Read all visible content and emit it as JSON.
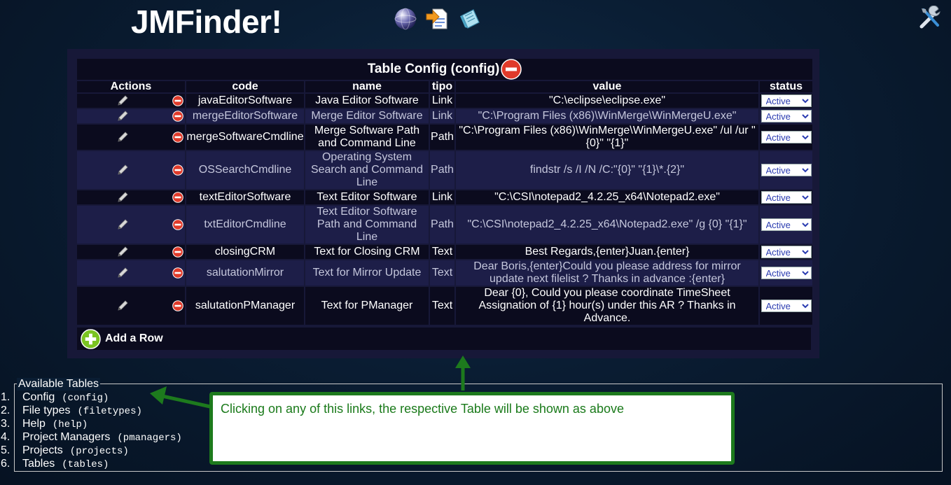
{
  "app": {
    "title": "JMFinder!",
    "icons": [
      "globe-icon",
      "import-icon",
      "notes-icon",
      "tools-icon"
    ]
  },
  "table_config": {
    "caption": "Table Config (config)",
    "headers": {
      "actions": "Actions",
      "code": "code",
      "name": "name",
      "tipo": "tipo",
      "value": "value",
      "status": "status"
    },
    "rows": [
      {
        "code": "javaEditorSoftware",
        "name": "Java Editor Software",
        "tipo": "Link",
        "value": "\"C:\\eclipse\\eclipse.exe\"",
        "status": "Active"
      },
      {
        "code": "mergeEditorSoftware",
        "name": "Merge Editor Software",
        "tipo": "Link",
        "value": "\"C:\\Program Files (x86)\\WinMerge\\WinMergeU.exe\"",
        "status": "Active"
      },
      {
        "code": "mergeSoftwareCmdline",
        "name": "Merge Software Path and Command Line",
        "tipo": "Path",
        "value": "\"C:\\Program Files (x86)\\WinMerge\\WinMergeU.exe\" /ul /ur \"{0}\" \"{1}\"",
        "status": "Active"
      },
      {
        "code": "OSSearchCmdline",
        "name": "Operating System Search and Command Line",
        "tipo": "Path",
        "value": "findstr /s /I /N /C:\"{0}\" \"{1}\\*.{2}\"",
        "status": "Active"
      },
      {
        "code": "textEditorSoftware",
        "name": "Text Editor Software",
        "tipo": "Link",
        "value": "\"C:\\CSI\\notepad2_4.2.25_x64\\Notepad2.exe\"",
        "status": "Active"
      },
      {
        "code": "txtEditorCmdline",
        "name": "Text Editor Software Path and Command Line",
        "tipo": "Path",
        "value": "\"C:\\CSI\\notepad2_4.2.25_x64\\Notepad2.exe\" /g {0} \"{1}\"",
        "status": "Active"
      },
      {
        "code": "closingCRM",
        "name": "Text for Closing CRM",
        "tipo": "Text",
        "value": "Best Regards,{enter}Juan.{enter}",
        "status": "Active"
      },
      {
        "code": "salutationMirror",
        "name": "Text for Mirror Update",
        "tipo": "Text",
        "value": "Dear Boris,{enter}Could you please address for mirror update next filelist ? Thanks in advance :{enter}",
        "status": "Active"
      },
      {
        "code": "salutationPManager",
        "name": "Text for PManager",
        "tipo": "Text",
        "value": "Dear {0}, Could you please coordinate TimeSheet Assignation of {1} hour(s) under this AR ? Thanks in Advance.",
        "status": "Active"
      }
    ],
    "add_row_label": "Add a Row"
  },
  "available_tables": {
    "legend": "Available Tables",
    "items": [
      {
        "num": "1.",
        "label": "Config",
        "code": "(config)"
      },
      {
        "num": "2.",
        "label": "File types",
        "code": "(filetypes)"
      },
      {
        "num": "3.",
        "label": "Help",
        "code": "(help)"
      },
      {
        "num": "4.",
        "label": "Project Managers",
        "code": "(pmanagers)"
      },
      {
        "num": "5.",
        "label": "Projects",
        "code": "(projects)"
      },
      {
        "num": "6.",
        "label": "Tables",
        "code": "(tables)"
      }
    ]
  },
  "callout": {
    "text": "Clicking on any of this links, the respective Table will be shown as above"
  },
  "colors": {
    "callout_green": "#1d7a1d",
    "delete_red": "#e03a2a",
    "add_green": "#7bc421",
    "panel_bg": "#171838"
  }
}
